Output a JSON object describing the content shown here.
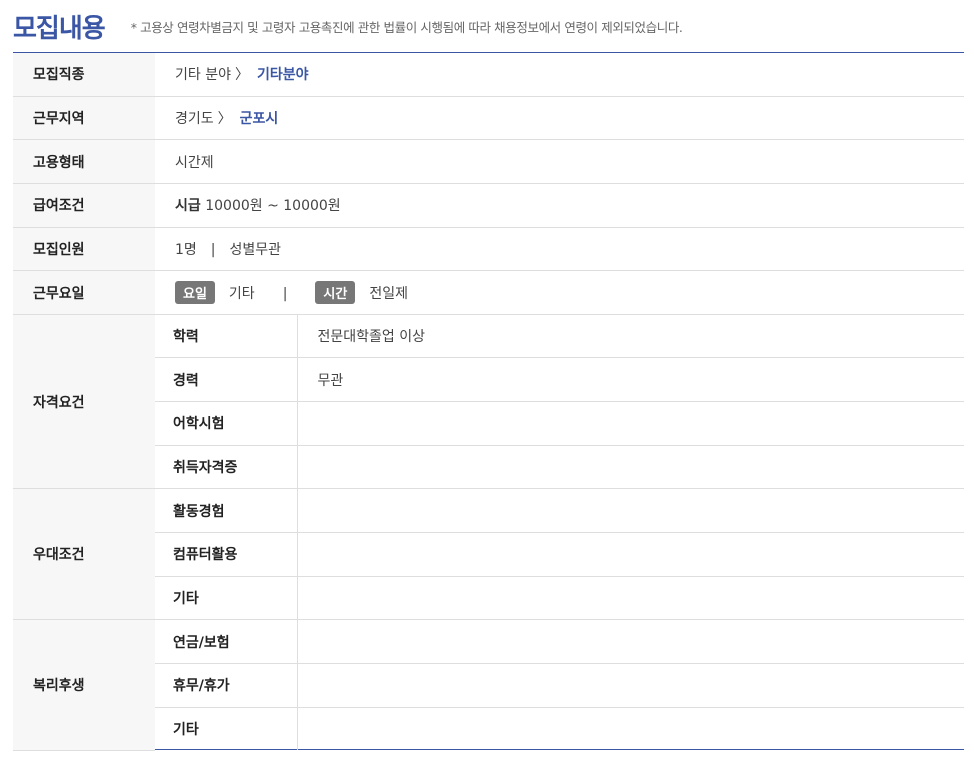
{
  "header": {
    "title": "모집내용",
    "notice": "* 고용상 연령차별금지 및 고령자 고용촉진에 관한 법률이 시행됨에 따라 채용정보에서 연령이 제외되었습니다."
  },
  "rows": {
    "job_type": {
      "label": "모집직종",
      "category": "기타 분야",
      "sep": "〉",
      "detail": "기타분야"
    },
    "location": {
      "label": "근무지역",
      "province": "경기도",
      "sep": "〉",
      "city": "군포시"
    },
    "employment": {
      "label": "고용형태",
      "value": "시간제"
    },
    "salary": {
      "label": "급여조건",
      "unit": "시급",
      "range": "10000원 ~ 10000원"
    },
    "headcount": {
      "label": "모집인원",
      "count": "1명",
      "sep": "|",
      "gender": "성별무관"
    },
    "schedule": {
      "label": "근무요일",
      "day_tag": "요일",
      "day_value": "기타",
      "sep": "|",
      "time_tag": "시간",
      "time_value": "전일제"
    }
  },
  "qualifications": {
    "label": "자격요건",
    "items": [
      {
        "name": "학력",
        "value": "전문대학졸업 이상"
      },
      {
        "name": "경력",
        "value": "무관"
      },
      {
        "name": "어학시험",
        "value": ""
      },
      {
        "name": "취득자격증",
        "value": ""
      }
    ]
  },
  "preferences": {
    "label": "우대조건",
    "items": [
      {
        "name": "활동경험",
        "value": ""
      },
      {
        "name": "컴퓨터활용",
        "value": ""
      },
      {
        "name": "기타",
        "value": ""
      }
    ]
  },
  "benefits": {
    "label": "복리후생",
    "items": [
      {
        "name": "연금/보험",
        "value": ""
      },
      {
        "name": "휴무/휴가",
        "value": ""
      },
      {
        "name": "기타",
        "value": ""
      }
    ]
  },
  "colors": {
    "accent": "#3a56a4",
    "tag_bg": "#777777",
    "header_bg": "#f7f7f7",
    "border": "#dedede"
  }
}
